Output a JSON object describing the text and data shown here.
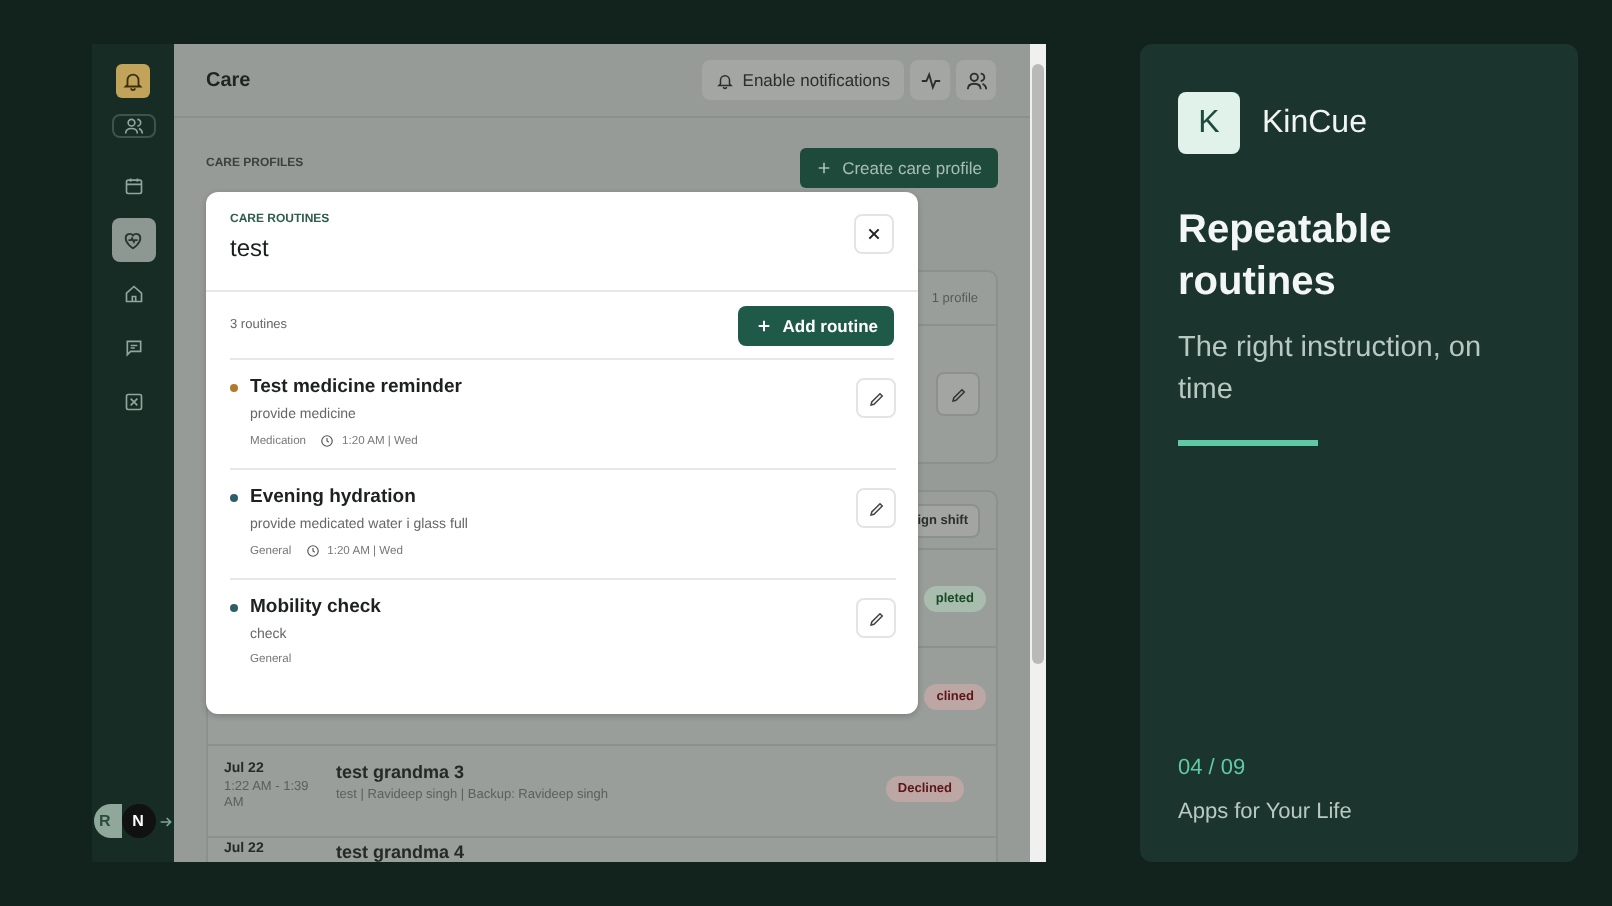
{
  "sidebar": {
    "items": [
      {
        "kind": "people",
        "selected": false
      },
      {
        "kind": "calendar",
        "selected": false
      },
      {
        "kind": "heart",
        "selected": true
      },
      {
        "kind": "home",
        "selected": false
      },
      {
        "kind": "message",
        "selected": false
      },
      {
        "kind": "cross",
        "selected": false
      }
    ],
    "avatars": [
      "R",
      "N"
    ]
  },
  "header": {
    "title": "Care",
    "notifications_button": "Enable notifications"
  },
  "content": {
    "section_label": "CARE PROFILES",
    "create_button": "Create care profile",
    "profiles_card": {
      "count": "1 profile"
    },
    "shifts": {
      "assign_button": "ign shift",
      "rows": [
        {
          "kind": "completed",
          "status": "pleted"
        },
        {
          "kind": "declined",
          "status": "clined"
        },
        {
          "kind": "declined",
          "date": "Jul 22",
          "time": "1:22 AM - 1:39 AM",
          "title": "test grandma 3",
          "details": "test | Ravideep singh | Backup: Ravideep singh",
          "status": "Declined"
        },
        {
          "kind": "plain",
          "date": "Jul 22",
          "title": "test grandma 4"
        }
      ]
    }
  },
  "modal": {
    "label": "CARE ROUTINES",
    "title": "test",
    "count": "3 routines",
    "add_button": "Add routine",
    "routines": [
      {
        "title": "Test medicine reminder",
        "description": "provide medicine",
        "category": "Medication",
        "schedule": "1:20 AM | Wed",
        "color": "#b07a2a"
      },
      {
        "title": "Evening hydration",
        "description": "provide medicated water i glass full",
        "category": "General",
        "schedule": "1:20 AM | Wed",
        "color": "#2f5d6b"
      },
      {
        "title": "Mobility check",
        "description": "check",
        "category": "General",
        "color": "#2f5d6b"
      }
    ]
  },
  "promo": {
    "logo_letter": "K",
    "brand": "KinCue",
    "headline": "Repeatable routines",
    "subtitle": "The right instruction, on time",
    "page": "04 / 09",
    "footer": "Apps for Your Life"
  }
}
